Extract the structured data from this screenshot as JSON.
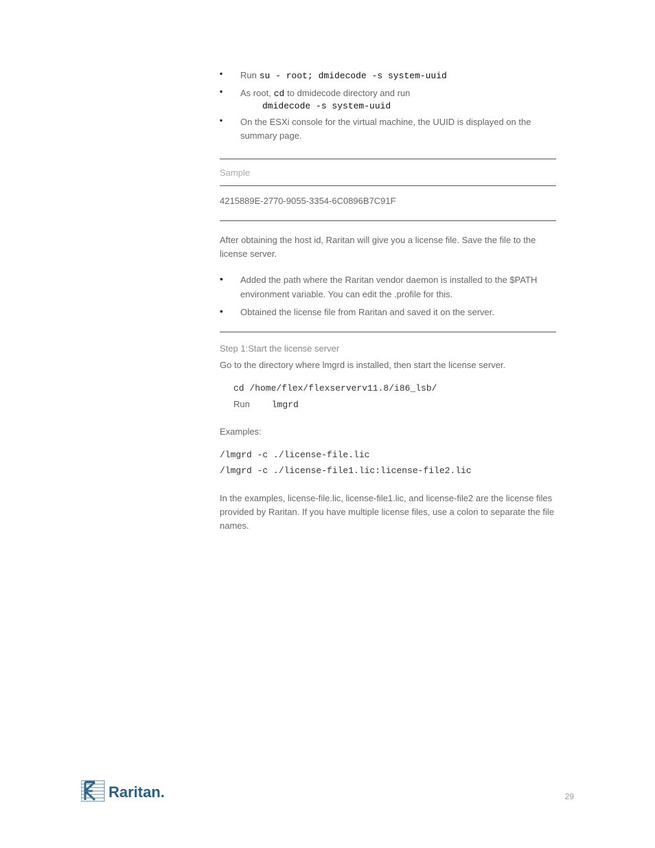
{
  "bullets": {
    "b1": {
      "lead": "Run",
      "code": "su - root; dmidecode -s system-uuid"
    },
    "b2": {
      "lead": "As root,",
      "codeA": "cd",
      "mid": "to dmidecode directory and run",
      "codeB": "dmidecode -s system-uuid"
    },
    "b3": {
      "text": "On the ESXi console for the virtual machine, the UUID is displayed on the summary page."
    }
  },
  "table": {
    "heading": "Sample",
    "row1": "4215889E-2770-9055-3354-6C0896B7C91F"
  },
  "after_table": "After obtaining the host id, Raritan will give you a license file. Save the file to the license server.",
  "bullets2": {
    "x1": "Added the path where the Raritan vendor daemon is installed to the $PATH environment variable. You can edit the .profile for this.",
    "x2": "Obtained the license file from Raritan and saved it on the server."
  },
  "step1": {
    "heading": "Step 1:Start the license server",
    "para": "Go to the directory where lmgrd is installed, then start the license server.",
    "cmd1": "cd /home/flex/flexserverv11.8/i86_lsb/",
    "lead2": "Run",
    "cmd2": "lmgrd"
  },
  "examples": {
    "heading": "Examples:",
    "line1": "/lmgrd -c ./license-file.lic",
    "line2": "/lmgrd -c ./license-file1.lic:license-file2.lic",
    "note": "In the examples, license-file.lic, license-file1.lic, and license-file2 are the license files provided by Raritan. If you have multiple license files, use a colon to separate the file names."
  },
  "footer": {
    "page": "29"
  },
  "logo": {
    "name": "Raritan."
  }
}
